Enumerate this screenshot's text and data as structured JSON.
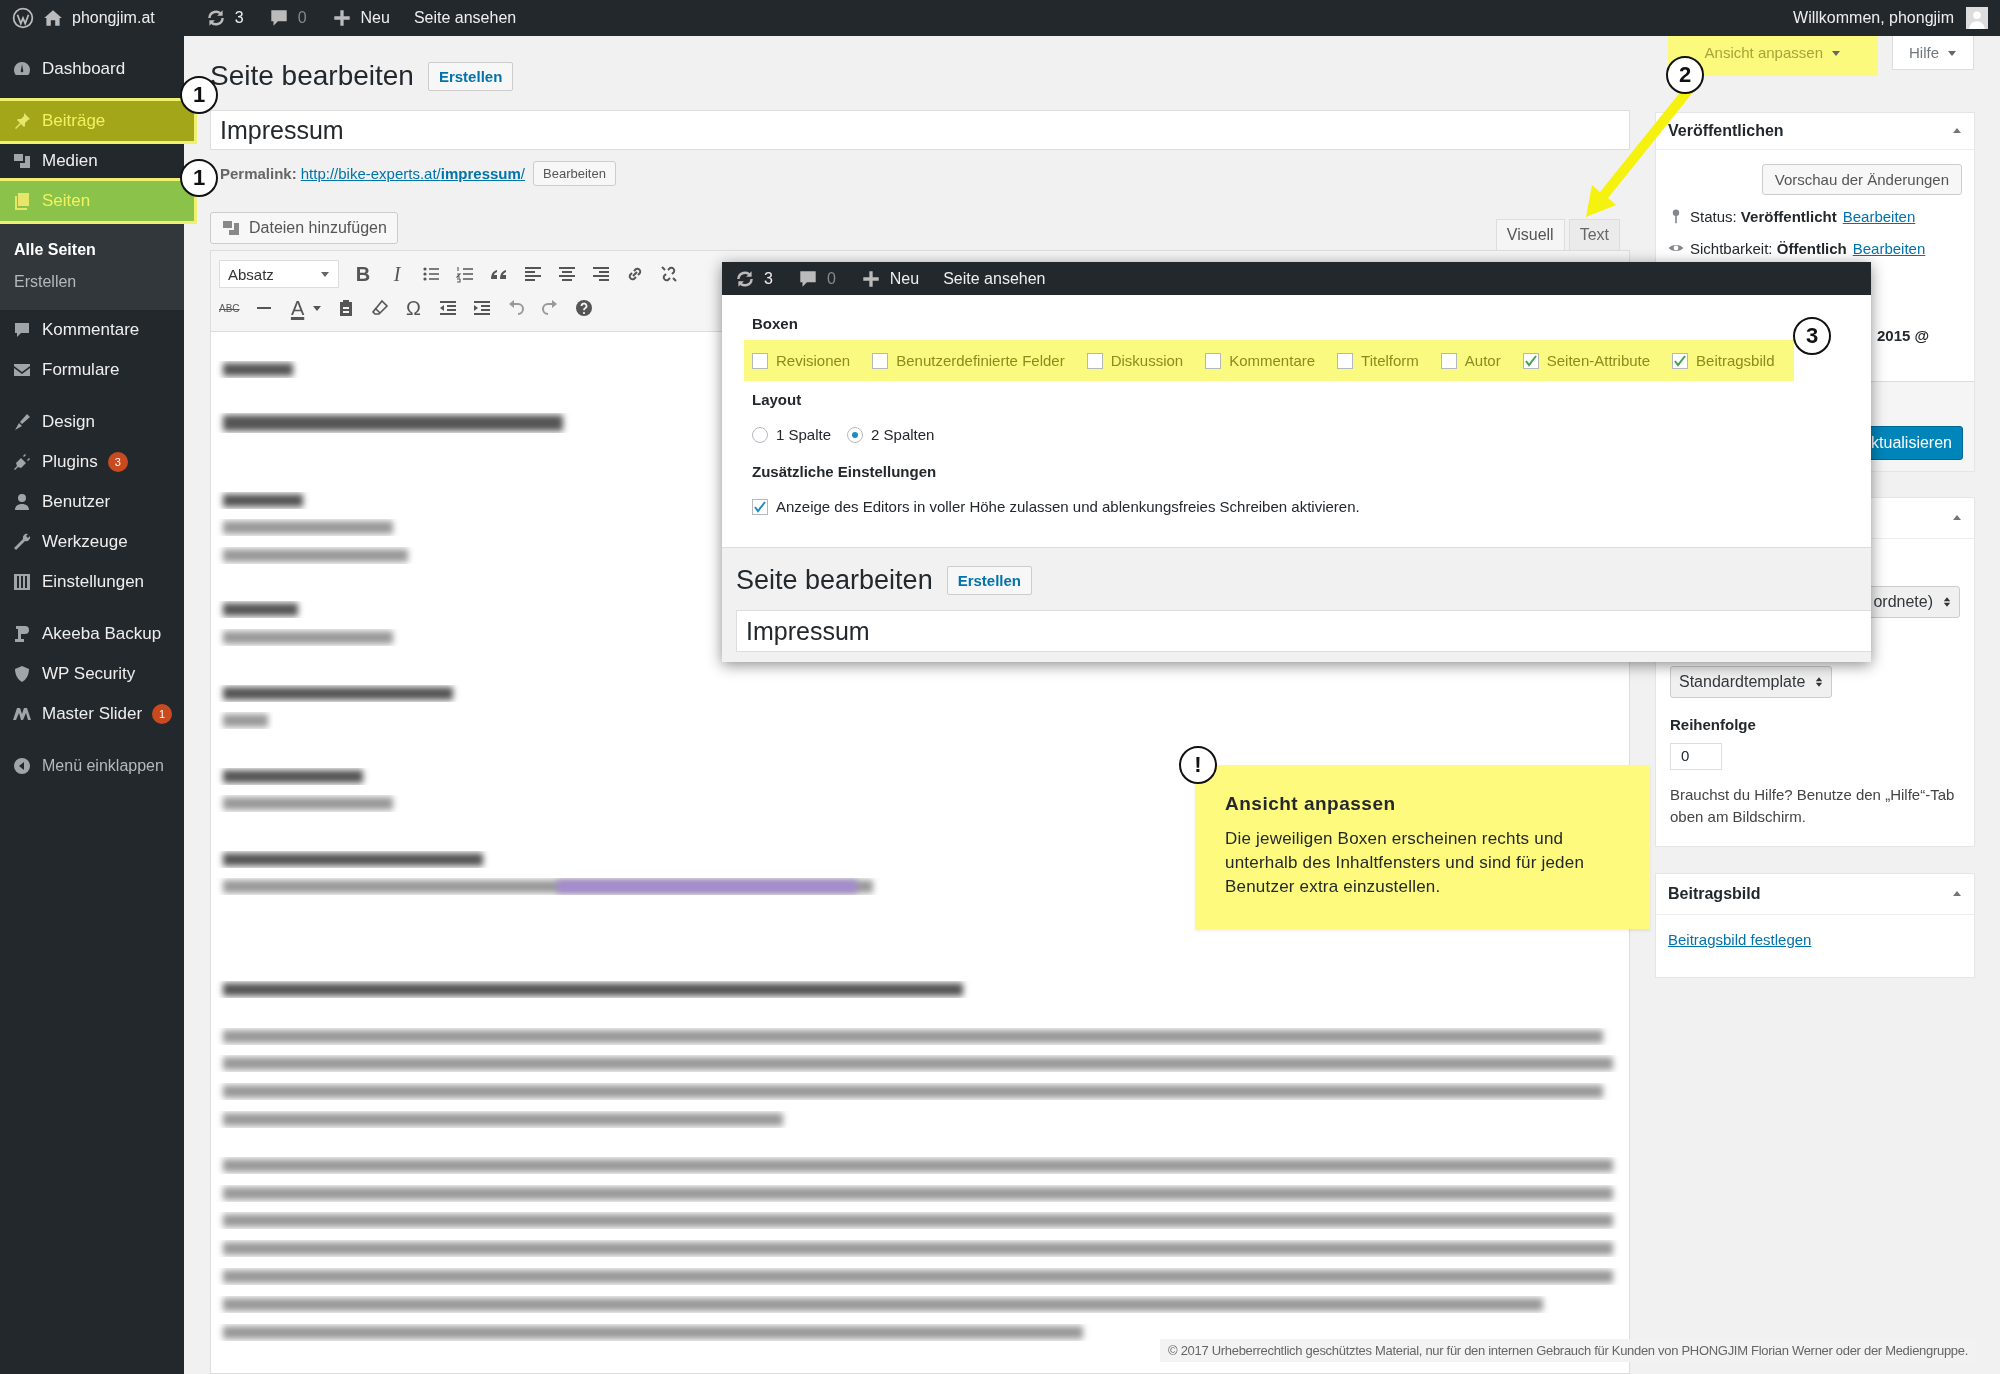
{
  "admin_bar": {
    "site": "phongjim.at",
    "updates": "3",
    "comments": "0",
    "new": "Neu",
    "view": "Seite ansehen",
    "greeting": "Willkommen, phongjim"
  },
  "sidebar": {
    "groups": [
      [
        {
          "label": "Dashboard",
          "selected": false,
          "highlighted": false
        }
      ],
      [
        {
          "label": "Beiträge",
          "selected": false,
          "highlighted": true
        },
        {
          "label": "Medien",
          "selected": false,
          "highlighted": false
        },
        {
          "label": "Seiten",
          "selected": true,
          "highlighted": true,
          "children": [
            {
              "label": "Alle Seiten",
              "selected": true
            },
            {
              "label": "Erstellen",
              "selected": false
            }
          ]
        },
        {
          "label": "Kommentare",
          "selected": false,
          "highlighted": false
        },
        {
          "label": "Formulare",
          "selected": false,
          "highlighted": false
        }
      ],
      [
        {
          "label": "Design",
          "selected": false,
          "highlighted": false
        },
        {
          "label": "Plugins",
          "selected": false,
          "highlighted": false,
          "badge": "3"
        },
        {
          "label": "Benutzer",
          "selected": false,
          "highlighted": false
        },
        {
          "label": "Werkzeuge",
          "selected": false,
          "highlighted": false
        },
        {
          "label": "Einstellungen",
          "selected": false,
          "highlighted": false
        }
      ],
      [
        {
          "label": "Akeeba Backup",
          "selected": false,
          "highlighted": false
        },
        {
          "label": "WP Security",
          "selected": false,
          "highlighted": false
        },
        {
          "label": "Master Slider",
          "selected": false,
          "highlighted": false,
          "badge": "1"
        }
      ]
    ],
    "collapse": "Menü einklappen"
  },
  "screen_tabs": [
    {
      "label": "Ansicht anpassen",
      "highlighted": true
    },
    {
      "label": "Hilfe",
      "highlighted": false
    }
  ],
  "page": {
    "heading": "Seite bearbeiten",
    "add_button": "Erstellen",
    "title": "Impressum",
    "permalink_label": "Permalink:",
    "permalink_url": "http://bike-experts.at/**impressum**/",
    "permalink_button": "Bearbeiten",
    "media_button": "Dateien hinzufügen",
    "editor_tabs": [
      {
        "label": "Visuell",
        "selected": true
      },
      {
        "label": "Text",
        "selected": false
      }
    ],
    "toolbar": [
      [
        {
          "kind": "select",
          "text": "Absatz"
        },
        {
          "kind": "bold",
          "text": "B"
        },
        {
          "kind": "italic",
          "text": "I"
        },
        {
          "kind": "icon"
        },
        {
          "kind": "icon"
        },
        {
          "kind": "icon"
        },
        {
          "kind": "icon"
        },
        {
          "kind": "icon"
        },
        {
          "kind": "icon"
        },
        {
          "kind": "icon"
        },
        {
          "kind": "icon"
        }
      ],
      [
        {
          "kind": "strike",
          "text": "ABC"
        },
        {
          "kind": "icon"
        },
        {
          "kind": "color",
          "text": "A"
        },
        {
          "kind": "icon"
        },
        {
          "kind": "icon"
        },
        {
          "kind": "glyph",
          "text": "Ω"
        },
        {
          "kind": "icon"
        },
        {
          "kind": "icon"
        },
        {
          "kind": "icon"
        },
        {
          "kind": "icon"
        },
        {
          "kind": "icon"
        }
      ]
    ]
  },
  "publish": {
    "title": "Veröffentlichen",
    "preview": "Vorschau der Änderungen",
    "status_label": "Status:",
    "status_value": "Veröffentlicht",
    "status_link": "Bearbeiten",
    "visibility_label": "Sichtbarkeit:",
    "visibility_value": "Öffentlich",
    "visibility_link": "Bearbeiten",
    "date_fragment": "2015 @",
    "update_button": "ktualisieren"
  },
  "attributes": {
    "parent_fragment": "ordnete)",
    "template": "Standardtemplate",
    "order_label": "Reihenfolge",
    "order_value": "0",
    "help": "Brauchst du Hilfe? Benutze den „Hilfe“-Tab oben am Bildschirm."
  },
  "featured_image": {
    "title": "Beitragsbild",
    "link": "Beitragsbild festlegen"
  },
  "overlay": {
    "admin_bar": {
      "updates": "3",
      "comments": "0",
      "new": "Neu",
      "view": "Seite ansehen"
    },
    "boxes_heading": "Boxen",
    "boxes_highlighted": true,
    "boxes": [
      {
        "label": "Revisionen",
        "checked": false
      },
      {
        "label": "Benutzerdefinierte Felder",
        "checked": false
      },
      {
        "label": "Diskussion",
        "checked": false
      },
      {
        "label": "Kommentare",
        "checked": false
      },
      {
        "label": "Titelform",
        "checked": false
      },
      {
        "label": "Autor",
        "checked": false
      },
      {
        "label": "Seiten-Attribute",
        "checked": true
      },
      {
        "label": "Beitragsbild",
        "checked": true
      }
    ],
    "layout_heading": "Layout",
    "layout_options": [
      {
        "label": "1 Spalte",
        "selected": false
      },
      {
        "label": "2 Spalten",
        "selected": true
      }
    ],
    "extra_heading": "Zusätzliche Einstellungen",
    "extra_options": [
      {
        "label": "Anzeige des Editors in voller Höhe zulassen und ablenkungsfreies Schreiben aktivieren.",
        "checked": true
      }
    ],
    "heading": "Seite bearbeiten",
    "add_button": "Erstellen",
    "title": "Impressum"
  },
  "annotations": {
    "markers": [
      "1",
      "1",
      "2",
      "3",
      "!"
    ],
    "note": {
      "title": "Ansicht anpassen",
      "body": "Die jeweiligen Boxen erscheinen rechts und unterhalb des Inhaltfensters und sind für jeden Benutzer extra einzustellen."
    }
  },
  "footer_notice": "© 2017 Urheberrechtlich geschütztes Material, nur für den internen Gebrauch für Kunden von PHONGJIM Florian Werner oder der Mediengruppe."
}
